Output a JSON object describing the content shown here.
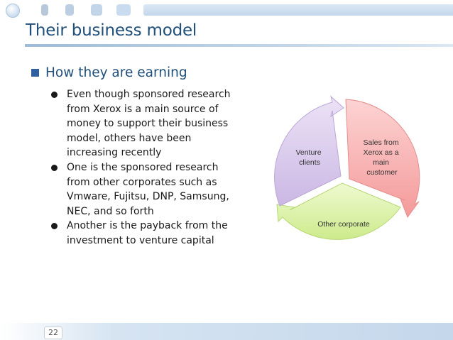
{
  "slide": {
    "title": "Their business model",
    "heading": "How they are earning",
    "bullets": [
      "Even though sponsored research from Xerox is a main source of money to support their business model, others have been increasing recently",
      "One is the sponsored research from other corporates such as Vmware, Fujitsu, DNP, Samsung, NEC, and so forth",
      "Another is the payback from the investment to venture capital"
    ],
    "page_number": "22"
  },
  "diagram": {
    "segments": [
      {
        "lines": [
          "Sales from",
          "Xerox as a",
          "main",
          "customer"
        ],
        "color": "#f6a5a5"
      },
      {
        "lines": [
          "Other corporate"
        ],
        "color": "#d9f2a6"
      },
      {
        "lines": [
          "Venture",
          "clients"
        ],
        "color": "#d8c8ec"
      }
    ]
  },
  "theme": {
    "title_color": "#1f4e79",
    "accent": "#2f5fa0"
  }
}
